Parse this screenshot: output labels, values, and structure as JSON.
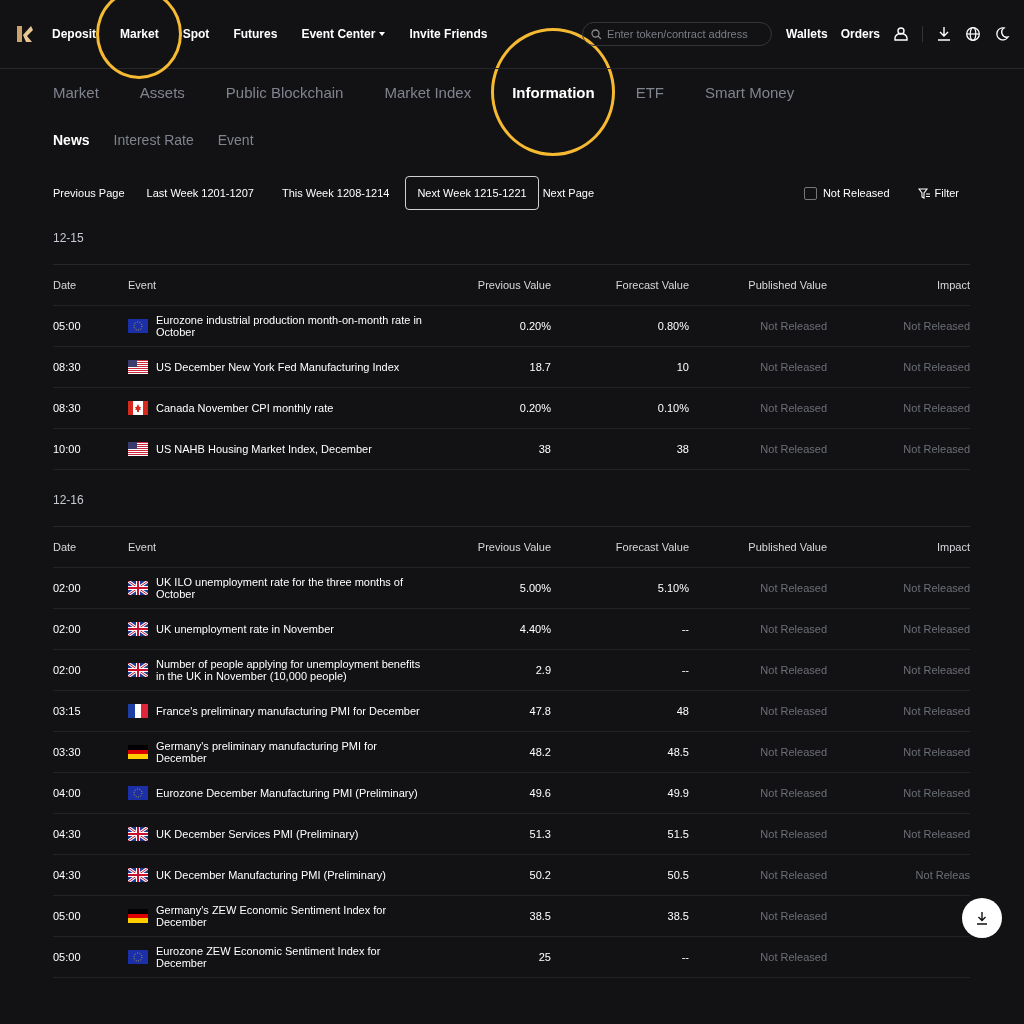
{
  "header": {
    "nav": [
      {
        "label": "Deposit",
        "circled": false,
        "dropdown": false
      },
      {
        "label": "Market",
        "circled": true,
        "dropdown": false
      },
      {
        "label": "Spot",
        "circled": false,
        "dropdown": false
      },
      {
        "label": "Futures",
        "circled": false,
        "dropdown": false
      },
      {
        "label": "Event Center",
        "circled": false,
        "dropdown": true
      },
      {
        "label": "Invite Friends",
        "circled": false,
        "dropdown": false
      }
    ],
    "search": {
      "placeholder": "Enter token/contract address"
    },
    "links": [
      "Wallets",
      "Orders"
    ]
  },
  "tabs": [
    {
      "label": "Market",
      "selected": false,
      "circled": false
    },
    {
      "label": "Assets",
      "selected": false,
      "circled": false
    },
    {
      "label": "Public Blockchain",
      "selected": false,
      "circled": false
    },
    {
      "label": "Market Index",
      "selected": false,
      "circled": false
    },
    {
      "label": "Information",
      "selected": true,
      "circled": true
    },
    {
      "label": "ETF",
      "selected": false,
      "circled": false
    },
    {
      "label": "Smart Money",
      "selected": false,
      "circled": false
    }
  ],
  "subtabs": [
    {
      "label": "News",
      "selected": true
    },
    {
      "label": "Interest Rate",
      "selected": false
    },
    {
      "label": "Event",
      "selected": false
    }
  ],
  "pager": {
    "previous": "Previous Page",
    "weeks": [
      {
        "label": "Last Week 1201-1207",
        "selected": false
      },
      {
        "label": "This Week 1208-1214",
        "selected": false
      },
      {
        "label": "Next Week 1215-1221",
        "selected": true
      }
    ],
    "next": "Next Page"
  },
  "not_released_filter": {
    "label": "Not Released",
    "checked": false
  },
  "filter_button": "Filter",
  "days": [
    {
      "date": "12-15",
      "columns": [
        "Date",
        "Event",
        "Previous Value",
        "Forecast Value",
        "Published Value",
        "Impact"
      ],
      "rows": [
        {
          "time": "05:00",
          "kind": "eu",
          "event": "Eurozone industrial production month-on-month rate in October",
          "previous": "0.20%",
          "forecast": "0.80%",
          "published": "Not Released",
          "impact": "Not Released"
        },
        {
          "time": "08:30",
          "kind": "us",
          "event": "US December New York Fed Manufacturing Index",
          "previous": "18.7",
          "forecast": "10",
          "published": "Not Released",
          "impact": "Not Released"
        },
        {
          "time": "08:30",
          "kind": "ca",
          "event": "Canada November CPI monthly rate",
          "previous": "0.20%",
          "forecast": "0.10%",
          "published": "Not Released",
          "impact": "Not Released"
        },
        {
          "time": "10:00",
          "kind": "us",
          "event": "US NAHB Housing Market Index, December",
          "previous": "38",
          "forecast": "38",
          "published": "Not Released",
          "impact": "Not Released"
        }
      ]
    },
    {
      "date": "12-16",
      "columns": [
        "Date",
        "Event",
        "Previous Value",
        "Forecast Value",
        "Published Value",
        "Impact"
      ],
      "rows": [
        {
          "time": "02:00",
          "kind": "uk",
          "event": "UK ILO unemployment rate for the three months of October",
          "previous": "5.00%",
          "forecast": "5.10%",
          "published": "Not Released",
          "impact": "Not Released"
        },
        {
          "time": "02:00",
          "kind": "uk",
          "event": "UK unemployment rate in November",
          "previous": "4.40%",
          "forecast": "--",
          "published": "Not Released",
          "impact": "Not Released"
        },
        {
          "time": "02:00",
          "kind": "uk",
          "event": "Number of people applying for unemployment benefits in the UK in November (10,000 people)",
          "previous": "2.9",
          "forecast": "--",
          "published": "Not Released",
          "impact": "Not Released"
        },
        {
          "time": "03:15",
          "kind": "fr",
          "event": "France's preliminary manufacturing PMI for December",
          "previous": "47.8",
          "forecast": "48",
          "published": "Not Released",
          "impact": "Not Released"
        },
        {
          "time": "03:30",
          "kind": "de",
          "event": "Germany's preliminary manufacturing PMI for December",
          "previous": "48.2",
          "forecast": "48.5",
          "published": "Not Released",
          "impact": "Not Released"
        },
        {
          "time": "04:00",
          "kind": "eu",
          "event": "Eurozone December Manufacturing PMI (Preliminary)",
          "previous": "49.6",
          "forecast": "49.9",
          "published": "Not Released",
          "impact": "Not Released"
        },
        {
          "time": "04:30",
          "kind": "uk",
          "event": "UK December Services PMI (Preliminary)",
          "previous": "51.3",
          "forecast": "51.5",
          "published": "Not Released",
          "impact": "Not Released"
        },
        {
          "time": "04:30",
          "kind": "uk",
          "event": "UK December Manufacturing PMI (Preliminary)",
          "previous": "50.2",
          "forecast": "50.5",
          "published": "Not Released",
          "impact": "Not Releas"
        },
        {
          "time": "05:00",
          "kind": "de",
          "event": "Germany's ZEW Economic Sentiment Index for December",
          "previous": "38.5",
          "forecast": "38.5",
          "published": "Not Released"
        },
        {
          "time": "05:00",
          "kind": "eu",
          "event": "Eurozone ZEW Economic Sentiment Index for December",
          "previous": "25",
          "forecast": "--",
          "published": "Not Released"
        }
      ]
    }
  ]
}
